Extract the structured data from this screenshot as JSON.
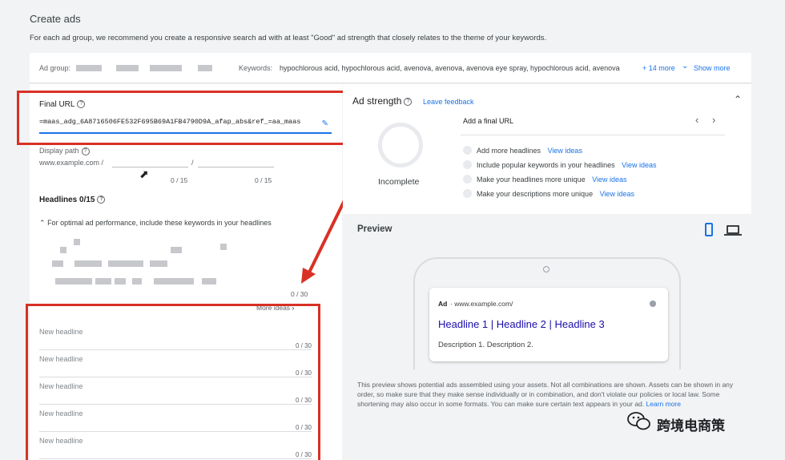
{
  "page": {
    "title": "Create ads",
    "intro": "For each ad group, we recommend you create a responsive search ad with at least \"Good\" ad strength that closely relates to the theme of your keywords."
  },
  "adgroup": {
    "label": "Ad group:",
    "keywords_label": "Keywords:",
    "keywords": "hypochlorous acid, hypochlorous acid, avenova, avenova, avenova eye spray, hypochlorous acid, avenova",
    "more": "+ 14 more",
    "show_more": "Show more"
  },
  "final_url": {
    "label": "Final URL",
    "value": "=maas_adg_6A8716506FE532F695B69A1FB4790D9A_afap_abs&ref_=aa_maas"
  },
  "display_path": {
    "label": "Display path",
    "base": "www.example.com /",
    "sep": "/",
    "count1": "0 / 15",
    "count2": "0 / 15"
  },
  "headlines": {
    "label": "Headlines 0/15",
    "hint": "For optimal ad performance, include these keywords in your headlines",
    "more_ideas": "More ideas",
    "items": [
      {
        "placeholder": "New headline",
        "count": "0 / 30"
      },
      {
        "placeholder": "New headline",
        "count": "0 / 30"
      },
      {
        "placeholder": "New headline",
        "count": "0 / 30"
      },
      {
        "placeholder": "New headline",
        "count": "0 / 30"
      },
      {
        "placeholder": "New headline",
        "count": "0 / 30"
      }
    ],
    "first_count": "0 / 30"
  },
  "ad_strength": {
    "label": "Ad strength",
    "feedback": "Leave feedback",
    "status": "Incomplete",
    "add_url": "Add a final URL",
    "suggestions": [
      {
        "text": "Add more headlines",
        "link": "View ideas"
      },
      {
        "text": "Include popular keywords in your headlines",
        "link": "View ideas"
      },
      {
        "text": "Make your headlines more unique",
        "link": "View ideas"
      },
      {
        "text": "Make your descriptions more unique",
        "link": "View ideas"
      }
    ]
  },
  "preview": {
    "label": "Preview",
    "ad_badge": "Ad",
    "ad_url": "· www.example.com/",
    "ad_headline": "Headline 1 | Headline 2 | Headline 3",
    "ad_description": "Description 1. Description 2.",
    "note": "This preview shows potential ads assembled using your assets. Not all combinations are shown. Assets can be shown in any order, so make sure that they make sense individually or in combination, and don't violate our policies or local law. Some shortening may also occur in some formats. You can make sure certain text appears in your ad.",
    "learn_more": "Learn more"
  },
  "watermark": "跨境电商策",
  "colors": {
    "accent": "#1a73e8",
    "annotation_red": "#d93025"
  }
}
